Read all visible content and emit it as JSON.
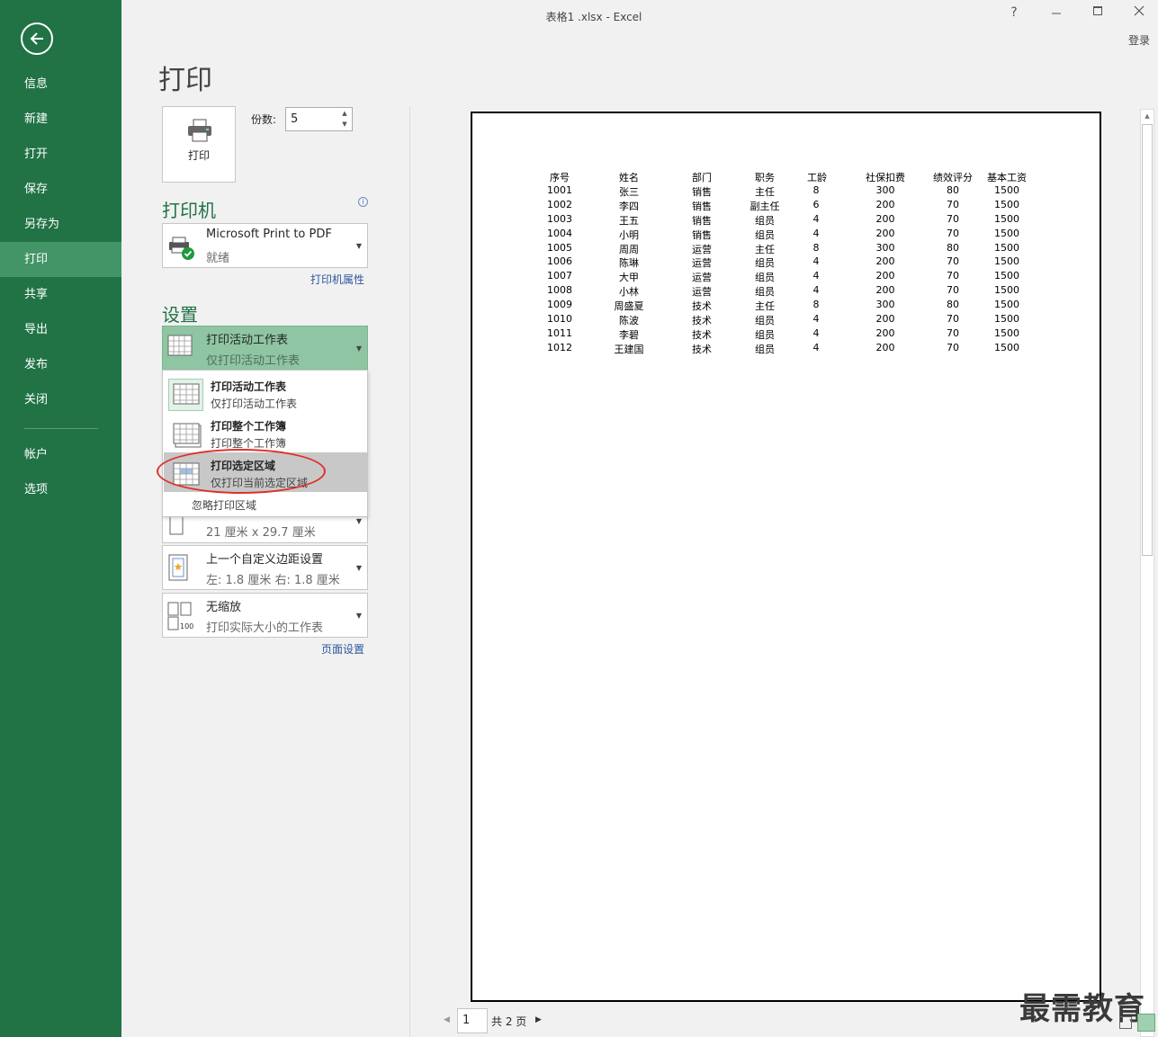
{
  "window": {
    "title": "表格1 .xlsx - Excel",
    "help": "?",
    "login": "登录"
  },
  "sidebar": {
    "items": [
      {
        "label": "信息"
      },
      {
        "label": "新建"
      },
      {
        "label": "打开"
      },
      {
        "label": "保存"
      },
      {
        "label": "另存为"
      },
      {
        "label": "打印"
      },
      {
        "label": "共享"
      },
      {
        "label": "导出"
      },
      {
        "label": "发布"
      },
      {
        "label": "关闭"
      },
      {
        "label": "帐户"
      },
      {
        "label": "选项"
      }
    ],
    "active": "打印"
  },
  "print": {
    "title": "打印",
    "button_label": "打印",
    "copies_label": "份数:",
    "copies_value": "5"
  },
  "printer": {
    "heading": "打印机",
    "name": "Microsoft Print to PDF",
    "status": "就绪",
    "properties_link": "打印机属性"
  },
  "settings": {
    "heading": "设置",
    "scope": {
      "main": "打印活动工作表",
      "sub": "仅打印活动工作表"
    },
    "menu": [
      {
        "main": "打印活动工作表",
        "sub": "仅打印活动工作表"
      },
      {
        "main": "打印整个工作簿",
        "sub": "打印整个工作簿"
      },
      {
        "main": "打印选定区域",
        "sub": "仅打印当前选定区域"
      }
    ],
    "ignore_print_area": "忽略打印区域",
    "paper_sub": "21 厘米 x 29.7 厘米",
    "margins": {
      "main": "上一个自定义边距设置",
      "sub": "左:  1.8 厘米     右:  1.8 厘米"
    },
    "scaling": {
      "main": "无缩放",
      "sub": "打印实际大小的工作表"
    },
    "page_setup_link": "页面设置"
  },
  "preview": {
    "headers": [
      "序号",
      "姓名",
      "部门",
      "职务",
      "工龄",
      "社保扣费",
      "绩效评分",
      "基本工资"
    ],
    "rows": [
      [
        "1001",
        "张三",
        "销售",
        "主任",
        "8",
        "300",
        "80",
        "1500"
      ],
      [
        "1002",
        "李四",
        "销售",
        "副主任",
        "6",
        "200",
        "70",
        "1500"
      ],
      [
        "1003",
        "王五",
        "销售",
        "组员",
        "4",
        "200",
        "70",
        "1500"
      ],
      [
        "1004",
        "小明",
        "销售",
        "组员",
        "4",
        "200",
        "70",
        "1500"
      ],
      [
        "1005",
        "周周",
        "运营",
        "主任",
        "8",
        "300",
        "80",
        "1500"
      ],
      [
        "1006",
        "陈琳",
        "运营",
        "组员",
        "4",
        "200",
        "70",
        "1500"
      ],
      [
        "1007",
        "大甲",
        "运营",
        "组员",
        "4",
        "200",
        "70",
        "1500"
      ],
      [
        "1008",
        "小林",
        "运营",
        "组员",
        "4",
        "200",
        "70",
        "1500"
      ],
      [
        "1009",
        "周盛夏",
        "技术",
        "主任",
        "8",
        "300",
        "80",
        "1500"
      ],
      [
        "1010",
        "陈波",
        "技术",
        "组员",
        "4",
        "200",
        "70",
        "1500"
      ],
      [
        "1011",
        "李碧",
        "技术",
        "组员",
        "4",
        "200",
        "70",
        "1500"
      ],
      [
        "1012",
        "王建国",
        "技术",
        "组员",
        "4",
        "200",
        "70",
        "1500"
      ]
    ],
    "current_page": "1",
    "total_pages": "共 2 页"
  },
  "watermark": "最需教育",
  "colors": {
    "sidebar": "#217346",
    "sidebar_active": "#439467",
    "accent": "#217346",
    "highlight": "#8fc5a2",
    "annotation": "#e0302a"
  }
}
